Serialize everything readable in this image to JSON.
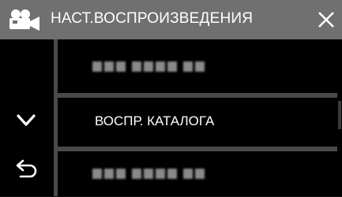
{
  "header": {
    "icon": "video-camera-icon",
    "title": "НАСТ.ВОСПРОИЗВЕДЕНИЯ",
    "close_icon": "close-icon"
  },
  "sidebar": {
    "items": [
      {
        "icon": "chevron-down-icon"
      },
      {
        "icon": "back-arrow-icon"
      }
    ]
  },
  "menu": {
    "items": [
      {
        "label": "",
        "blurred": true
      },
      {
        "label": "ВОСПР. КАТАЛОГА",
        "blurred": false
      },
      {
        "label": "",
        "blurred": true
      }
    ]
  },
  "colors": {
    "header_bg": "#707070",
    "body_bg": "#000000",
    "separator": "#4a4a4a",
    "text": "#ffffff"
  }
}
